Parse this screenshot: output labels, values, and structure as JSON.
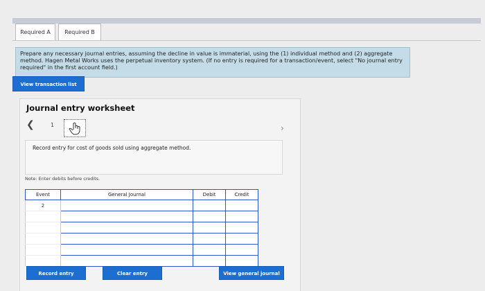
{
  "tabs": [
    {
      "label": "Required A"
    },
    {
      "label": "Required B"
    }
  ],
  "instruction": "Prepare any necessary journal entries, assuming the decline in value is immaterial, using the (1) individual method and (2) aggregate method. Hagen Metal Works uses the perpetual inventory system. (If no entry is required for a transaction/event, select \"No journal entry required\" in the first account field.)",
  "view_transaction_list_label": "View transaction list",
  "worksheet": {
    "title": "Journal entry worksheet",
    "prev_icon": "chevron-left-icon",
    "page_number": "1",
    "next_icon": "chevron-right-icon",
    "cursor_icon": "hand-pointer-icon",
    "description": "Record entry for cost of goods sold using aggregate method.",
    "note": "Note: Enter debits before credits.",
    "table": {
      "headers": [
        "Event",
        "General Journal",
        "Debit",
        "Credit"
      ],
      "rows": [
        {
          "event": "2"
        },
        {
          "event": ""
        },
        {
          "event": ""
        },
        {
          "event": ""
        },
        {
          "event": ""
        },
        {
          "event": ""
        }
      ]
    }
  },
  "buttons": {
    "record_entry": "Record entry",
    "clear_entry": "Clear entry",
    "view_general_journal": "View general journal"
  },
  "colors": {
    "accent": "#1c6fd1",
    "instruction_bg": "#c3dce8",
    "table_border": "#2a56c6"
  }
}
